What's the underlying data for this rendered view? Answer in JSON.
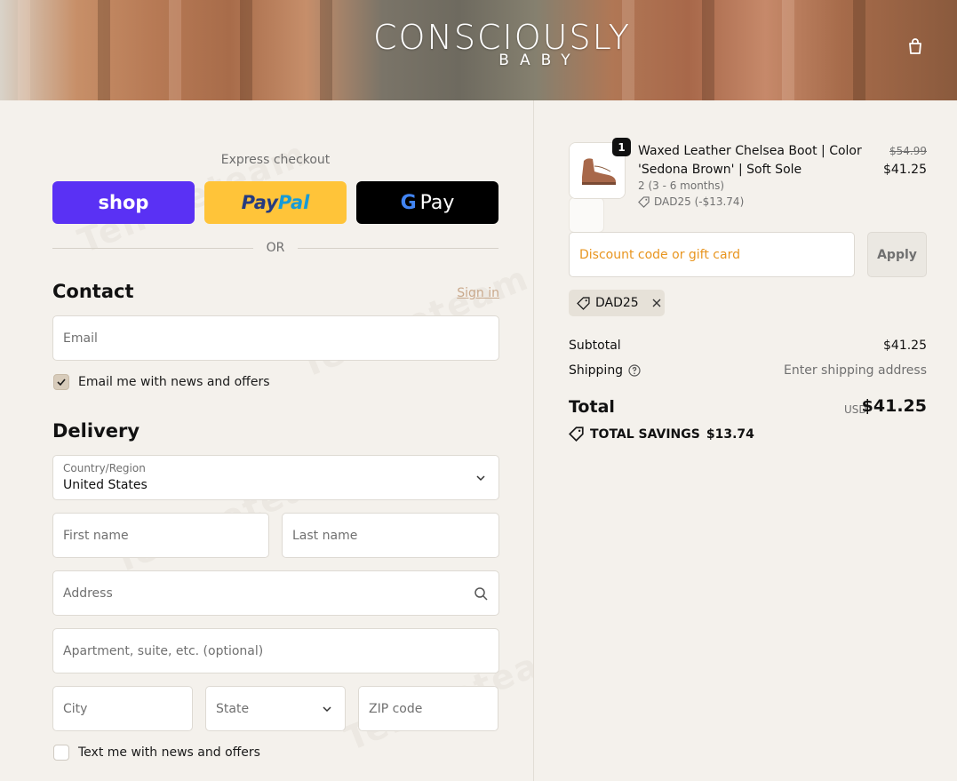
{
  "header": {
    "brand_main": "CONSCIOUSLY",
    "brand_sub": "BABY",
    "cart_icon": "shopping-bag-icon"
  },
  "express": {
    "label": "Express checkout",
    "shop_label": "shop",
    "paypal_label_1": "Pay",
    "paypal_label_2": "Pal",
    "gpay_g": "G",
    "gpay_label": "Pay",
    "or_label": "OR"
  },
  "contact": {
    "title": "Contact",
    "sign_in": "Sign in",
    "email_placeholder": "Email",
    "news_label": "Email me with news and offers",
    "news_checked": true
  },
  "delivery": {
    "title": "Delivery",
    "country_label": "Country/Region",
    "country_value": "United States",
    "first_name": "First name",
    "last_name": "Last name",
    "address": "Address",
    "apartment": "Apartment, suite, etc. (optional)",
    "city": "City",
    "state": "State",
    "zip": "ZIP code",
    "text_label": "Text me with news and offers",
    "text_checked": false
  },
  "order": {
    "quantity": "1",
    "product_title": "Waxed Leather Chelsea Boot | Color 'Sedona Brown' | Soft Sole",
    "variant": "2 (3 - 6 months)",
    "discount_line": "DAD25 (-$13.74)",
    "price_original": "$54.99",
    "price_current": "$41.25",
    "discount_placeholder": "Discount code or gift card",
    "apply_label": "Apply",
    "applied_code": "DAD25",
    "subtotal_label": "Subtotal",
    "subtotal_value": "$41.25",
    "shipping_label": "Shipping",
    "shipping_value": "Enter shipping address",
    "total_label": "Total",
    "currency": "USD",
    "total_value": "$41.25",
    "savings_label": "TOTAL SAVINGS",
    "savings_value": "$13.74"
  },
  "colors": {
    "shop": "#5a31f4",
    "paypal": "#ffc439",
    "gpay": "#000000",
    "discount_placeholder": "#e8951f",
    "sign_in_link": "#c9a98c"
  }
}
